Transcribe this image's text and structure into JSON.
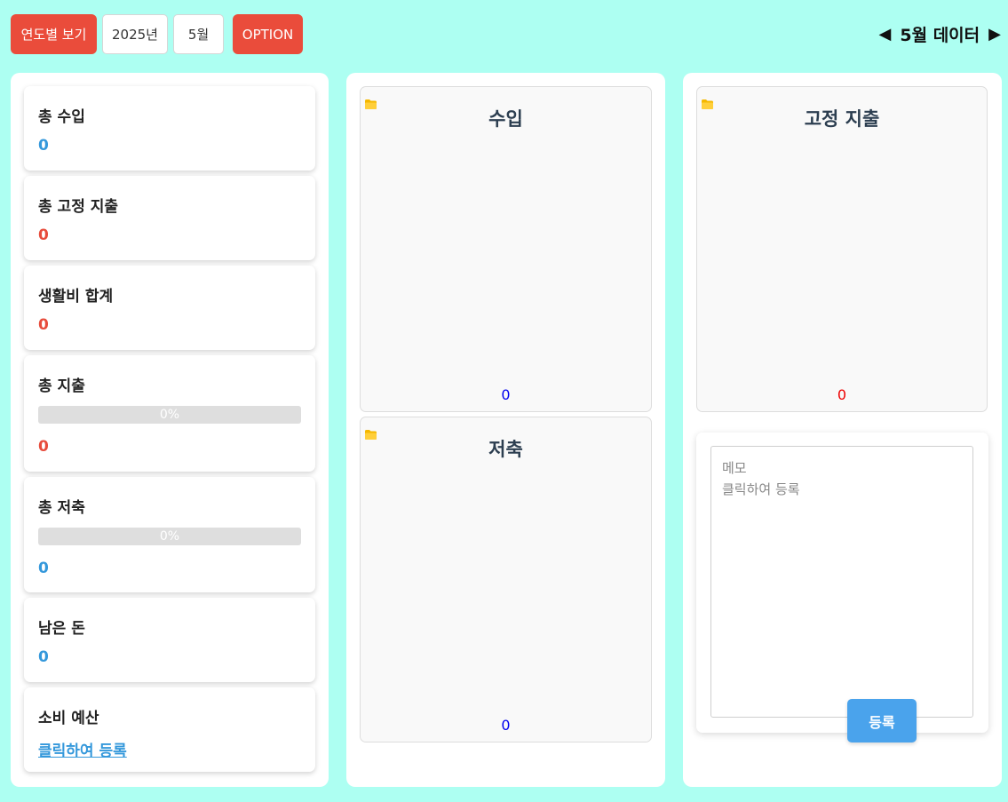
{
  "toolbar": {
    "yearly_view_label": "연도별 보기",
    "year_value": "2025년",
    "month_value": "5월",
    "option_label": "OPTION",
    "month_title": "5월 데이터",
    "prev_arrow": "◀",
    "next_arrow": "▶"
  },
  "summary": {
    "total_income": {
      "label": "총 수입",
      "value": "0"
    },
    "total_fixed": {
      "label": "총 고정 지출",
      "value": "0"
    },
    "living_total": {
      "label": "생활비 합계",
      "value": "0"
    },
    "total_expense": {
      "label": "총 지출",
      "progress": "0%",
      "value": "0"
    },
    "total_saving": {
      "label": "총 저축",
      "progress": "0%",
      "value": "0"
    },
    "remaining": {
      "label": "남은 돈",
      "value": "0"
    },
    "budget": {
      "label": "소비 예산",
      "link": "클릭하여 등록"
    }
  },
  "panels": {
    "income": {
      "title": "수입",
      "total": "0",
      "total_color": "#0000ee"
    },
    "saving": {
      "title": "저축",
      "total": "0",
      "total_color": "#0000ee"
    },
    "fixed": {
      "title": "고정 지출",
      "total": "0",
      "total_color": "#ee0000"
    }
  },
  "memo": {
    "text": "메모\n클릭하여 등록",
    "submit_label": "등록"
  },
  "colors": {
    "background": "#adfff2",
    "accent_red": "#ea4c3b",
    "accent_blue": "#3498db"
  }
}
